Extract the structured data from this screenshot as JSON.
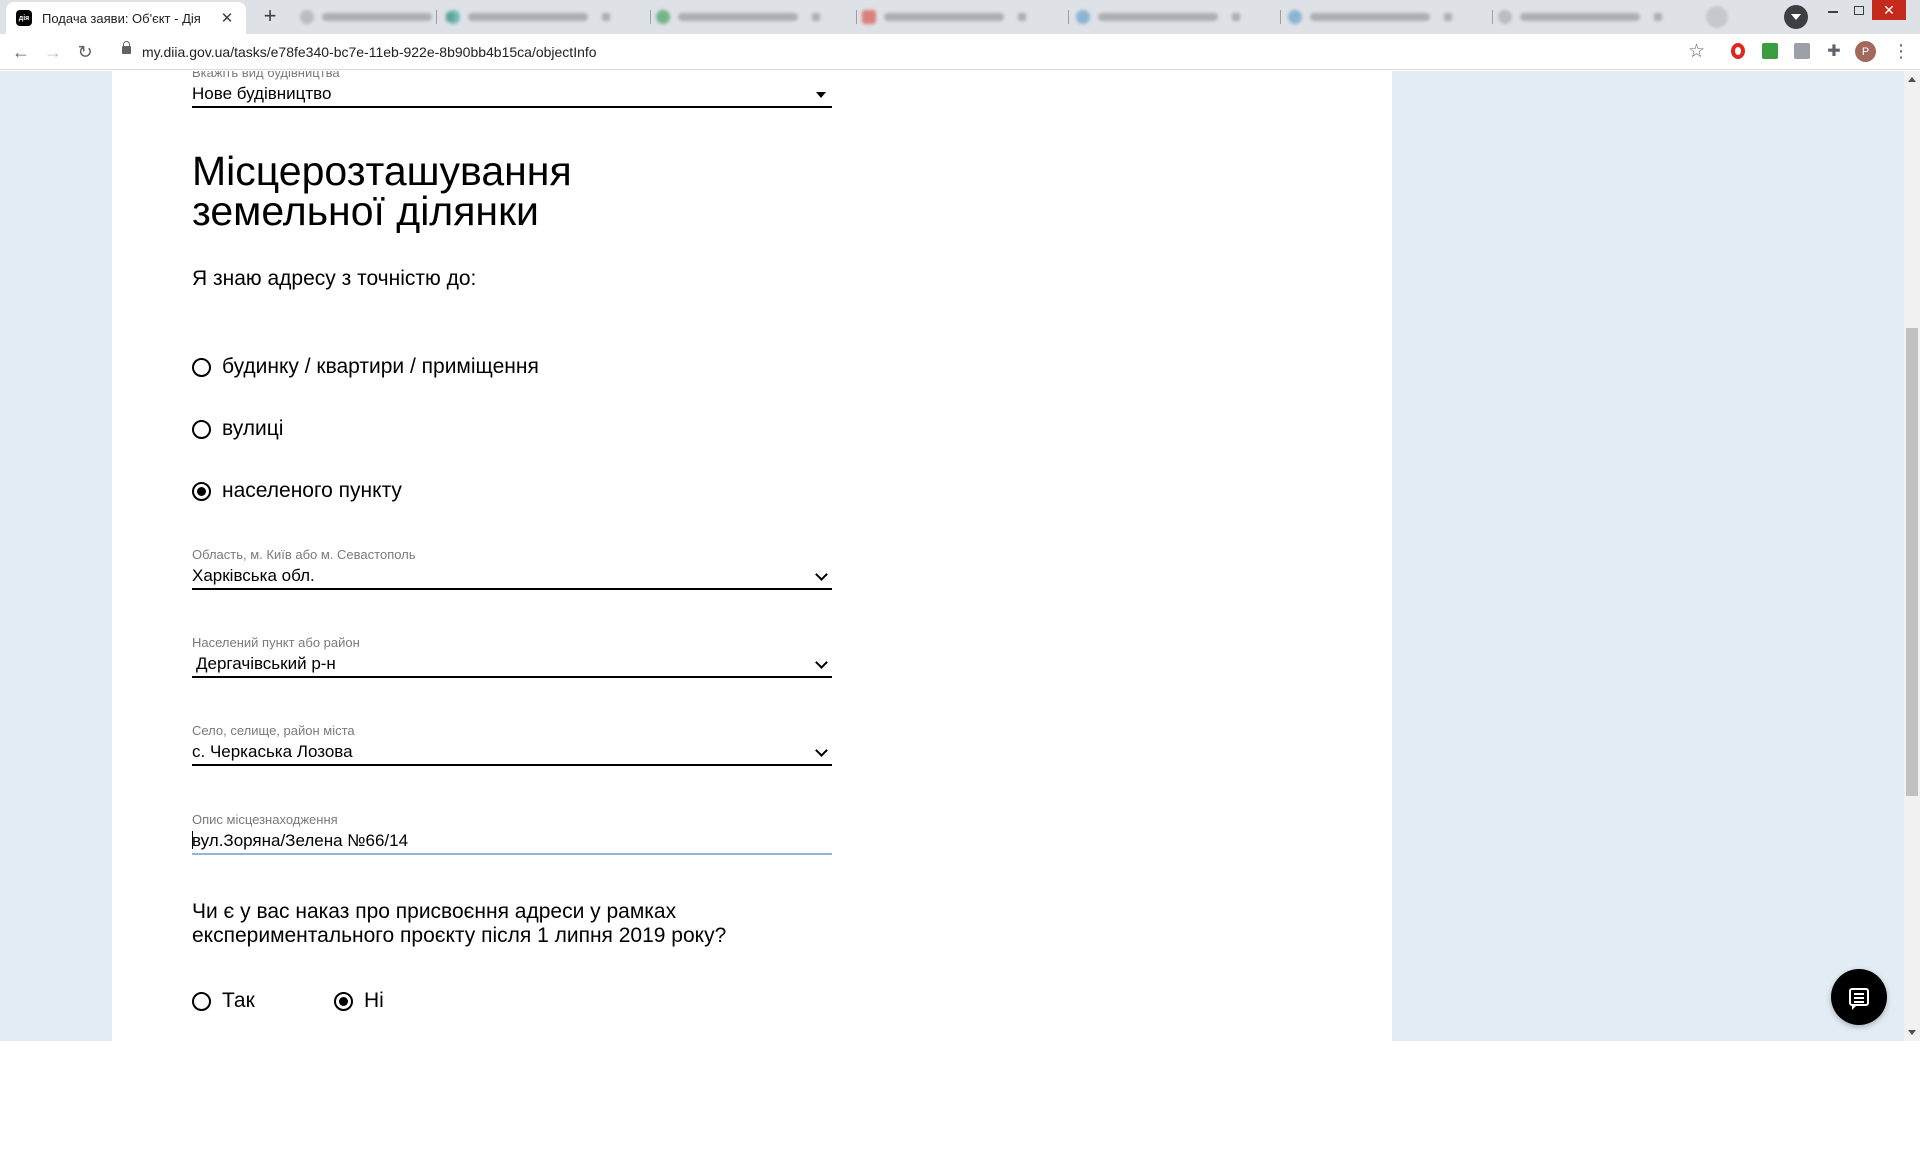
{
  "browser": {
    "tab_title": "Подача заяви: Об'єкт - Дія",
    "tab_favicon_text": "дія",
    "new_tab_symbol": "+",
    "url": "my.diia.gov.ua/tasks/e78fe340-bc7e-11eb-922e-8b90bb4b15ca/objectInfo",
    "profile_initial": "P"
  },
  "page": {
    "construction_type": {
      "label": "Вкажіть вид будівництва",
      "value": "Нове будівництво"
    },
    "section_title_line1": "Місцерозташування",
    "section_title_line2": "земельної ділянки",
    "address_question": "Я знаю адресу з точністю до:",
    "address_options": [
      {
        "label": "будинку / квартири / приміщення",
        "checked": false
      },
      {
        "label": "вулиці",
        "checked": false
      },
      {
        "label": "населеного пункту",
        "checked": true
      }
    ],
    "region": {
      "label": "Область, м. Київ або м. Севастополь",
      "value": "Харківська обл."
    },
    "district": {
      "label": "Населений пункт або район",
      "value": "Дергачівський р-н"
    },
    "village": {
      "label": "Село, селище, район міста",
      "value": "с. Черкаська Лозова"
    },
    "location_description": {
      "label": "Опис місцезнаходження",
      "value": "вул.Зоряна/Зелена №66/14"
    },
    "order_question_line1": "Чи є у вас наказ про присвоєння адреси у рамках",
    "order_question_line2": "експериментального проєкту після 1 липня 2019 року?",
    "order_options": [
      {
        "label": "Так",
        "checked": false
      },
      {
        "label": "Ні",
        "checked": true
      }
    ]
  },
  "colors": {
    "page_background": "#e2ecf4",
    "content_background": "#ffffff",
    "text": "#000000",
    "focus_underline": "#96b4d8"
  },
  "icons": {
    "chat": "chat-icon",
    "dropdown": "chevron-down-icon"
  }
}
